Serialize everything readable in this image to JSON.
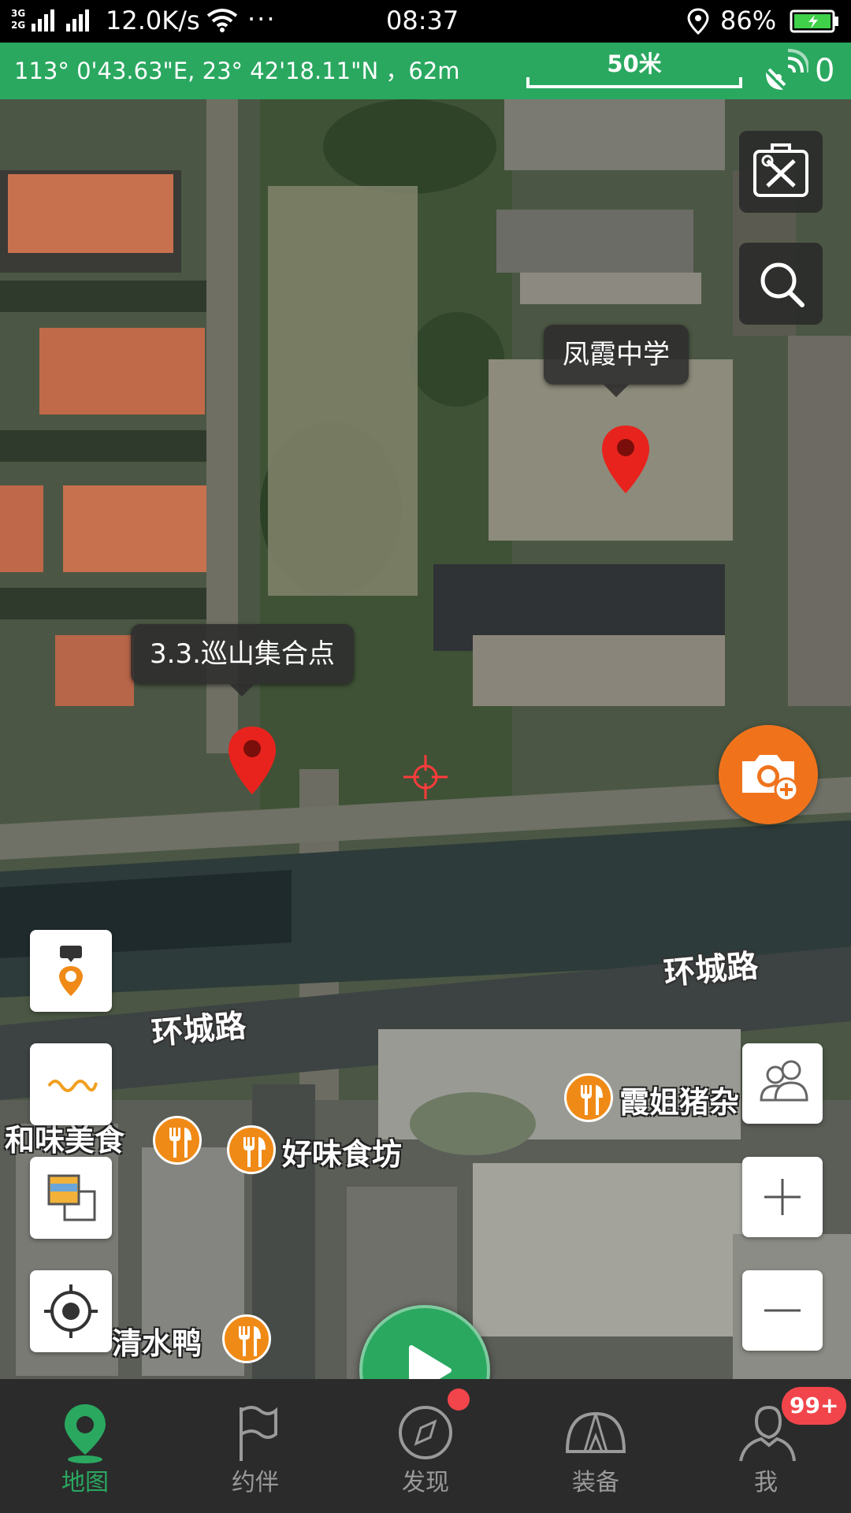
{
  "status_bar": {
    "network": "3G 2G",
    "net_speed": "12.0K/s",
    "more": "···",
    "time": "08:37",
    "battery": "86%"
  },
  "info_bar": {
    "coordinates": "113°  0'43.63\"E,  23°  42'18.11\"N ，62m",
    "scale": "50米",
    "satellite_count": "0"
  },
  "map": {
    "markers": [
      {
        "label": "凤霞中学"
      },
      {
        "label": "3.3.巡山集合点"
      }
    ],
    "roads": [
      "环城路",
      "环城路"
    ],
    "pois": [
      "霞姐猪杂",
      "和味美食",
      "好味食坊",
      "清水鸭"
    ]
  },
  "nav": {
    "tabs": [
      {
        "label": "地图",
        "active": true
      },
      {
        "label": "约伴"
      },
      {
        "label": "发现"
      },
      {
        "label": "装备"
      },
      {
        "label": "我"
      }
    ],
    "me_badge": "99+"
  },
  "colors": {
    "primary": "#2aa860",
    "accent_orange": "#f0731c",
    "marker_red": "#e8231d",
    "badge_red": "#f2454b"
  },
  "icons": [
    "toolbox-icon",
    "search-icon",
    "camera-icon",
    "layer-icon",
    "track-icon",
    "map-layers-icon",
    "locate-icon",
    "play-icon",
    "people-icon",
    "zoom-in-icon",
    "zoom-out-icon"
  ]
}
